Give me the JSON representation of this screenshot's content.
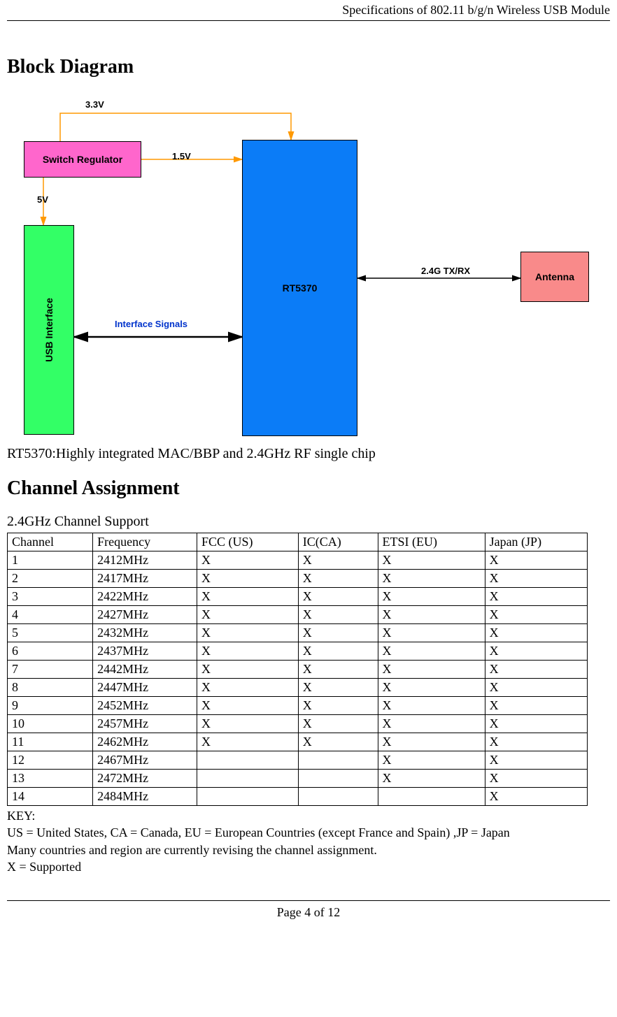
{
  "header": {
    "title": "Specifications of 802.11 b/g/n Wireless USB Module"
  },
  "section1": {
    "title": "Block Diagram",
    "labels": {
      "v33": "3.3V",
      "v15": "1.5V",
      "v5": "5V",
      "interface_signals": "Interface Signals",
      "txrx": "2.4G TX/RX"
    },
    "boxes": {
      "switch_regulator": "Switch Regulator",
      "usb_interface": "USB Interface",
      "rt5370": "RT5370",
      "antenna": "Antenna"
    },
    "caption": "RT5370:Highly integrated MAC/BBP and 2.4GHz RF single chip"
  },
  "section2": {
    "title": "Channel Assignment",
    "subheading": "2.4GHz Channel Support",
    "columns": [
      "Channel",
      "Frequency",
      "FCC (US)",
      "IC(CA)",
      "ETSI (EU)",
      "Japan (JP)"
    ],
    "rows": [
      {
        "ch": "1",
        "freq": "2412MHz",
        "fcc": "X",
        "ic": "X",
        "etsi": "X",
        "jp": "X"
      },
      {
        "ch": "2",
        "freq": "2417MHz",
        "fcc": "X",
        "ic": "X",
        "etsi": "X",
        "jp": "X"
      },
      {
        "ch": "3",
        "freq": "2422MHz",
        "fcc": "X",
        "ic": "X",
        "etsi": "X",
        "jp": "X"
      },
      {
        "ch": "4",
        "freq": "2427MHz",
        "fcc": "X",
        "ic": "X",
        "etsi": "X",
        "jp": "X"
      },
      {
        "ch": "5",
        "freq": "2432MHz",
        "fcc": "X",
        "ic": "X",
        "etsi": "X",
        "jp": "X"
      },
      {
        "ch": "6",
        "freq": "2437MHz",
        "fcc": "X",
        "ic": "X",
        "etsi": "X",
        "jp": "X"
      },
      {
        "ch": "7",
        "freq": "2442MHz",
        "fcc": "X",
        "ic": "X",
        "etsi": "X",
        "jp": "X"
      },
      {
        "ch": "8",
        "freq": "2447MHz",
        "fcc": "X",
        "ic": "X",
        "etsi": "X",
        "jp": "X"
      },
      {
        "ch": "9",
        "freq": "2452MHz",
        "fcc": "X",
        "ic": "X",
        "etsi": "X",
        "jp": "X"
      },
      {
        "ch": "10",
        "freq": "2457MHz",
        "fcc": "X",
        "ic": "X",
        "etsi": "X",
        "jp": "X"
      },
      {
        "ch": "11",
        "freq": "2462MHz",
        "fcc": "X",
        "ic": "X",
        "etsi": "X",
        "jp": "X"
      },
      {
        "ch": "12",
        "freq": "2467MHz",
        "fcc": "",
        "ic": "",
        "etsi": "X",
        "jp": "X"
      },
      {
        "ch": "13",
        "freq": "2472MHz",
        "fcc": "",
        "ic": "",
        "etsi": "X",
        "jp": "X"
      },
      {
        "ch": "14",
        "freq": "2484MHz",
        "fcc": "",
        "ic": "",
        "etsi": "",
        "jp": "X"
      }
    ],
    "key": {
      "heading": "KEY:",
      "line1": "US = United States, CA = Canada, EU = European Countries (except France and Spain) ,JP = Japan",
      "line2": "Many countries and region are currently revising the channel assignment.",
      "line3": "X = Supported"
    }
  },
  "footer": {
    "page": "Page 4 of 12"
  },
  "chart_data": {
    "type": "table",
    "title": "2.4GHz Channel Support",
    "columns": [
      "Channel",
      "Frequency",
      "FCC (US)",
      "IC(CA)",
      "ETSI (EU)",
      "Japan (JP)"
    ],
    "rows": [
      [
        "1",
        "2412MHz",
        "X",
        "X",
        "X",
        "X"
      ],
      [
        "2",
        "2417MHz",
        "X",
        "X",
        "X",
        "X"
      ],
      [
        "3",
        "2422MHz",
        "X",
        "X",
        "X",
        "X"
      ],
      [
        "4",
        "2427MHz",
        "X",
        "X",
        "X",
        "X"
      ],
      [
        "5",
        "2432MHz",
        "X",
        "X",
        "X",
        "X"
      ],
      [
        "6",
        "2437MHz",
        "X",
        "X",
        "X",
        "X"
      ],
      [
        "7",
        "2442MHz",
        "X",
        "X",
        "X",
        "X"
      ],
      [
        "8",
        "2447MHz",
        "X",
        "X",
        "X",
        "X"
      ],
      [
        "9",
        "2452MHz",
        "X",
        "X",
        "X",
        "X"
      ],
      [
        "10",
        "2457MHz",
        "X",
        "X",
        "X",
        "X"
      ],
      [
        "11",
        "2462MHz",
        "X",
        "X",
        "X",
        "X"
      ],
      [
        "12",
        "2467MHz",
        "",
        "",
        "X",
        "X"
      ],
      [
        "13",
        "2472MHz",
        "",
        "",
        "X",
        "X"
      ],
      [
        "14",
        "2484MHz",
        "",
        "",
        "",
        "X"
      ]
    ]
  }
}
